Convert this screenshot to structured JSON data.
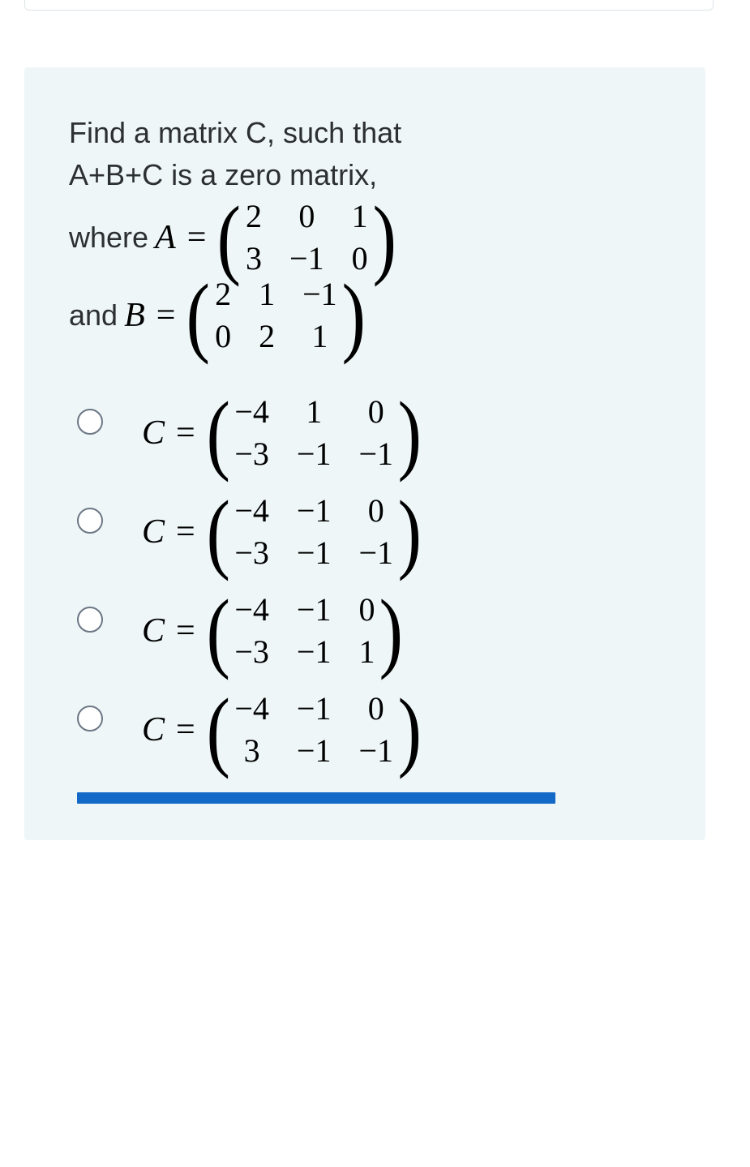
{
  "question": {
    "line1": "Find a matrix C, such that",
    "line2": "A+B+C is a zero matrix,",
    "where_label": "where",
    "and_label": "and",
    "varA": "A",
    "varB": "B",
    "eq": "=",
    "matrixA": {
      "r1c1": "2",
      "r1c2": "0",
      "r1c3": "1",
      "r2c1": "3",
      "r2c2": "−1",
      "r2c3": "0"
    },
    "matrixB": {
      "r1c1": "2",
      "r1c2": "1",
      "r1c3": "−1",
      "r2c1": "0",
      "r2c2": "2",
      "r2c3": "1"
    }
  },
  "options": [
    {
      "varC": "C",
      "eq": "=",
      "matrix": {
        "r1c1": "−4",
        "r1c2": "1",
        "r1c3": "0",
        "r2c1": "−3",
        "r2c2": "−1",
        "r2c3": "−1"
      }
    },
    {
      "varC": "C",
      "eq": "=",
      "matrix": {
        "r1c1": "−4",
        "r1c2": "−1",
        "r1c3": "0",
        "r2c1": "−3",
        "r2c2": "−1",
        "r2c3": "−1"
      }
    },
    {
      "varC": "C",
      "eq": "=",
      "matrix": {
        "r1c1": "−4",
        "r1c2": "−1",
        "r1c3": "0",
        "r2c1": "−3",
        "r2c2": "−1",
        "r2c3": "1"
      }
    },
    {
      "varC": "C",
      "eq": "=",
      "matrix": {
        "r1c1": "−4",
        "r1c2": "−1",
        "r1c3": "0",
        "r2c1": "3",
        "r2c2": "−1",
        "r2c3": "−1"
      }
    }
  ]
}
